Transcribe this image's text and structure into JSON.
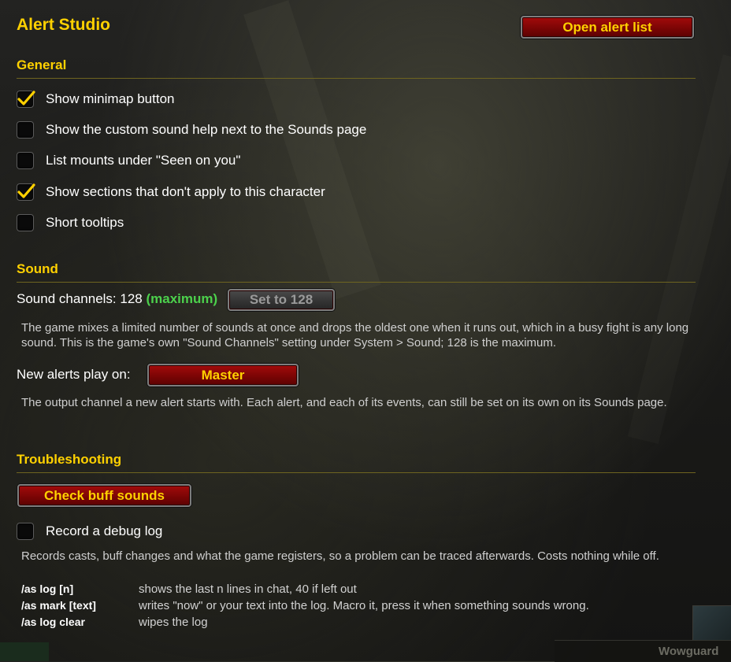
{
  "header": {
    "title": "Alert Studio",
    "open_list_label": "Open alert list"
  },
  "general": {
    "title": "General",
    "options": [
      {
        "label": "Show minimap button",
        "checked": true
      },
      {
        "label": "Show the custom sound help next to the Sounds page",
        "checked": false
      },
      {
        "label": "List mounts under \"Seen on you\"",
        "checked": false
      },
      {
        "label": "Show sections that don't apply to this character",
        "checked": true
      },
      {
        "label": "Short tooltips",
        "checked": false
      }
    ]
  },
  "sound": {
    "title": "Sound",
    "channels_label": "Sound channels: 128",
    "channels_status": "(maximum)",
    "set_button_label": "Set to 128",
    "channels_desc": "The game mixes a limited number of sounds at once and drops the oldest one when it runs out, which in a busy fight is any long sound. This is the game's own \"Sound Channels\" setting under System > Sound; 128 is the maximum.",
    "new_alerts_label": "New alerts play on:",
    "new_alerts_value": "Master",
    "new_alerts_desc": "The output channel a new alert starts with. Each alert, and each of its events, can still be set on its own on its Sounds page."
  },
  "troubleshooting": {
    "title": "Troubleshooting",
    "check_button_label": "Check buff sounds",
    "debug_log_label": "Record a debug log",
    "debug_log_checked": false,
    "debug_desc": "Records casts, buff changes and what the game registers, so a problem can be traced afterwards. Costs nothing while off.",
    "commands": [
      {
        "cmd": "/as log [n]",
        "desc": "shows the last n lines in chat, 40 if left out"
      },
      {
        "cmd": "/as mark [text]",
        "desc": "writes \"now\" or your text into the log. Macro it, press it when something sounds wrong."
      },
      {
        "cmd": "/as log clear",
        "desc": "wipes the log"
      }
    ]
  },
  "background": {
    "corner_label": "Wowguard"
  },
  "colors": {
    "accent_gold": "#ffd100",
    "status_green": "#4cd14c",
    "button_red": "#8a0808"
  }
}
